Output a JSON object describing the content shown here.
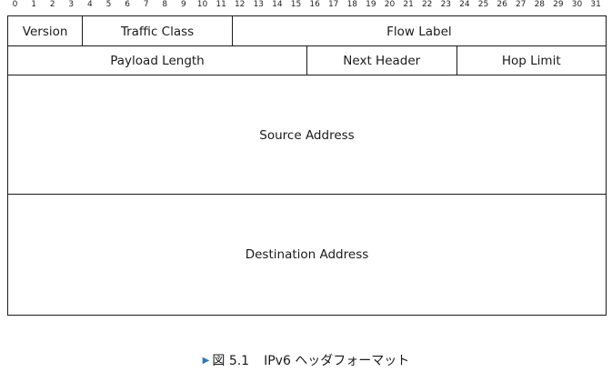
{
  "bit_ruler": [
    "0",
    "1",
    "2",
    "3",
    "4",
    "5",
    "6",
    "7",
    "8",
    "9",
    "10",
    "11",
    "12",
    "13",
    "14",
    "15",
    "16",
    "17",
    "18",
    "19",
    "20",
    "21",
    "22",
    "23",
    "24",
    "25",
    "26",
    "27",
    "28",
    "29",
    "30",
    "31"
  ],
  "rows": [
    [
      {
        "label": "Version",
        "bits": 4
      },
      {
        "label": "Traffic Class",
        "bits": 8
      },
      {
        "label": "Flow Label",
        "bits": 20
      }
    ],
    [
      {
        "label": "Payload Length",
        "bits": 16
      },
      {
        "label": "Next Header",
        "bits": 8
      },
      {
        "label": "Hop Limit",
        "bits": 8
      }
    ],
    [
      {
        "label": "Source Address",
        "bits": 32
      }
    ],
    [
      {
        "label": "Destination Address",
        "bits": 32
      }
    ]
  ],
  "caption": {
    "marker": "▶",
    "figure_number": "図 5.1",
    "title": "IPv6 ヘッダフォーマット"
  },
  "colors": {
    "border": "#1a1a1a",
    "caption_marker": "#2a78c2"
  }
}
